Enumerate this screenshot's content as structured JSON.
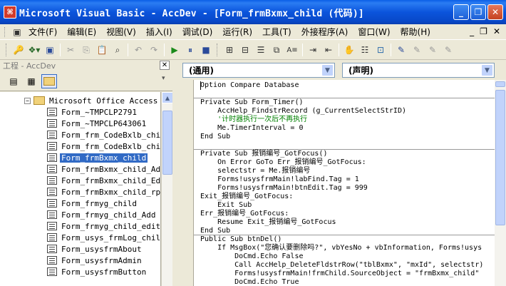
{
  "window": {
    "title": "Microsoft Visual Basic - AccDev - [Form_frmBxmx_child (代码)]",
    "app_icon": "vba-icon",
    "buttons": [
      "minimize",
      "restore",
      "close"
    ]
  },
  "menu": {
    "items": [
      "文件(F)",
      "编辑(E)",
      "视图(V)",
      "插入(I)",
      "调试(D)",
      "运行(R)",
      "工具(T)",
      "外接程序(A)",
      "窗口(W)",
      "帮助(H)"
    ],
    "mdi_controls": [
      "_",
      "❐",
      "✕"
    ]
  },
  "toolbar": {
    "icons": [
      "access-icon",
      "insert-module-icon",
      "save-icon",
      "cut-icon",
      "copy-icon",
      "paste-icon",
      "find-icon",
      "undo-icon",
      "redo-icon",
      "run-icon",
      "break-icon",
      "reset-icon",
      "design-mode-icon",
      "project-explorer-icon",
      "properties-icon",
      "object-browser-icon",
      "toolbox-icon",
      "indent-icon",
      "outdent-icon",
      "hand-icon",
      "list-icon",
      "comment-icon",
      "uncomment-icon"
    ]
  },
  "project": {
    "title": "工程 - AccDev",
    "root_label": "Microsoft Office Access 类",
    "selected_index": 4,
    "items": [
      "Form_~TMPCLP2791",
      "Form_~TMPCLP643061",
      "Form_frm_CodeBxlb_chil",
      "Form_frm_CodeBxlb_chil",
      "Form_frmBxmx_child",
      "Form_frmBxmx_child_Add",
      "Form_frmBxmx_child_Edi",
      "Form_frmBxmx_child_rpt",
      "Form_frmyg_child",
      "Form_frmyg_child_Add",
      "Form_frmyg_child_edit",
      "Form_usys_frmLog_child",
      "Form_usysfrmAbout",
      "Form_usysfrmAdmin",
      "Form_usysfrmButton"
    ]
  },
  "code": {
    "object_combo": "(通用)",
    "procedure_combo": "(声明)",
    "lines": [
      {
        "text": "Option Compare Database",
        "kind": "kw"
      },
      {
        "text": "",
        "kind": "plain"
      },
      {
        "text": "Private Sub Form_Timer()",
        "kind": "kw"
      },
      {
        "text": "    AccHelp_FindstrRecord (g_CurrentSelectStrID)",
        "kind": "plain"
      },
      {
        "text": "    '计时器执行一次后不再执行",
        "kind": "cm"
      },
      {
        "text": "    Me.TimerInterval = 0",
        "kind": "plain"
      },
      {
        "text": "End Sub",
        "kind": "kw"
      },
      {
        "text": "",
        "kind": "plain"
      },
      {
        "text": "Private Sub 报销编号_GotFocus()",
        "kind": "kw"
      },
      {
        "text": "    On Error GoTo Err_报销编号_GotFocus:",
        "kind": "kw"
      },
      {
        "text": "    selectstr = Me.报销编号",
        "kind": "plain"
      },
      {
        "text": "    Forms!usysfrmMain!labFind.Tag = 1",
        "kind": "plain"
      },
      {
        "text": "    Forms!usysfrmMain!btnEdit.Tag = 999",
        "kind": "plain"
      },
      {
        "text": "Exit_报销编号_GotFocus:",
        "kind": "plain"
      },
      {
        "text": "    Exit Sub",
        "kind": "kw"
      },
      {
        "text": "Err_报销编号_GotFocus:",
        "kind": "plain"
      },
      {
        "text": "    Resume Exit_报销编号_GotFocus",
        "kind": "kw"
      },
      {
        "text": "End Sub",
        "kind": "kw"
      },
      {
        "text": "Public Sub btnDel()",
        "kind": "kw"
      },
      {
        "text": "    If MsgBox(\"您确认要删除吗?\", vbYesNo + vbInformation, Forms!usys",
        "kind": "plain"
      },
      {
        "text": "        DoCmd.Echo False",
        "kind": "plain"
      },
      {
        "text": "        Call AccHelp_DeleteFldstrRow(\"tblBxmx\", \"mxId\", selectstr)",
        "kind": "plain"
      },
      {
        "text": "        Forms!usysfrmMain!frmChild.SourceObject = \"frmBxmx_child\"",
        "kind": "plain"
      },
      {
        "text": "        DoCmd.Echo True",
        "kind": "plain"
      }
    ]
  }
}
